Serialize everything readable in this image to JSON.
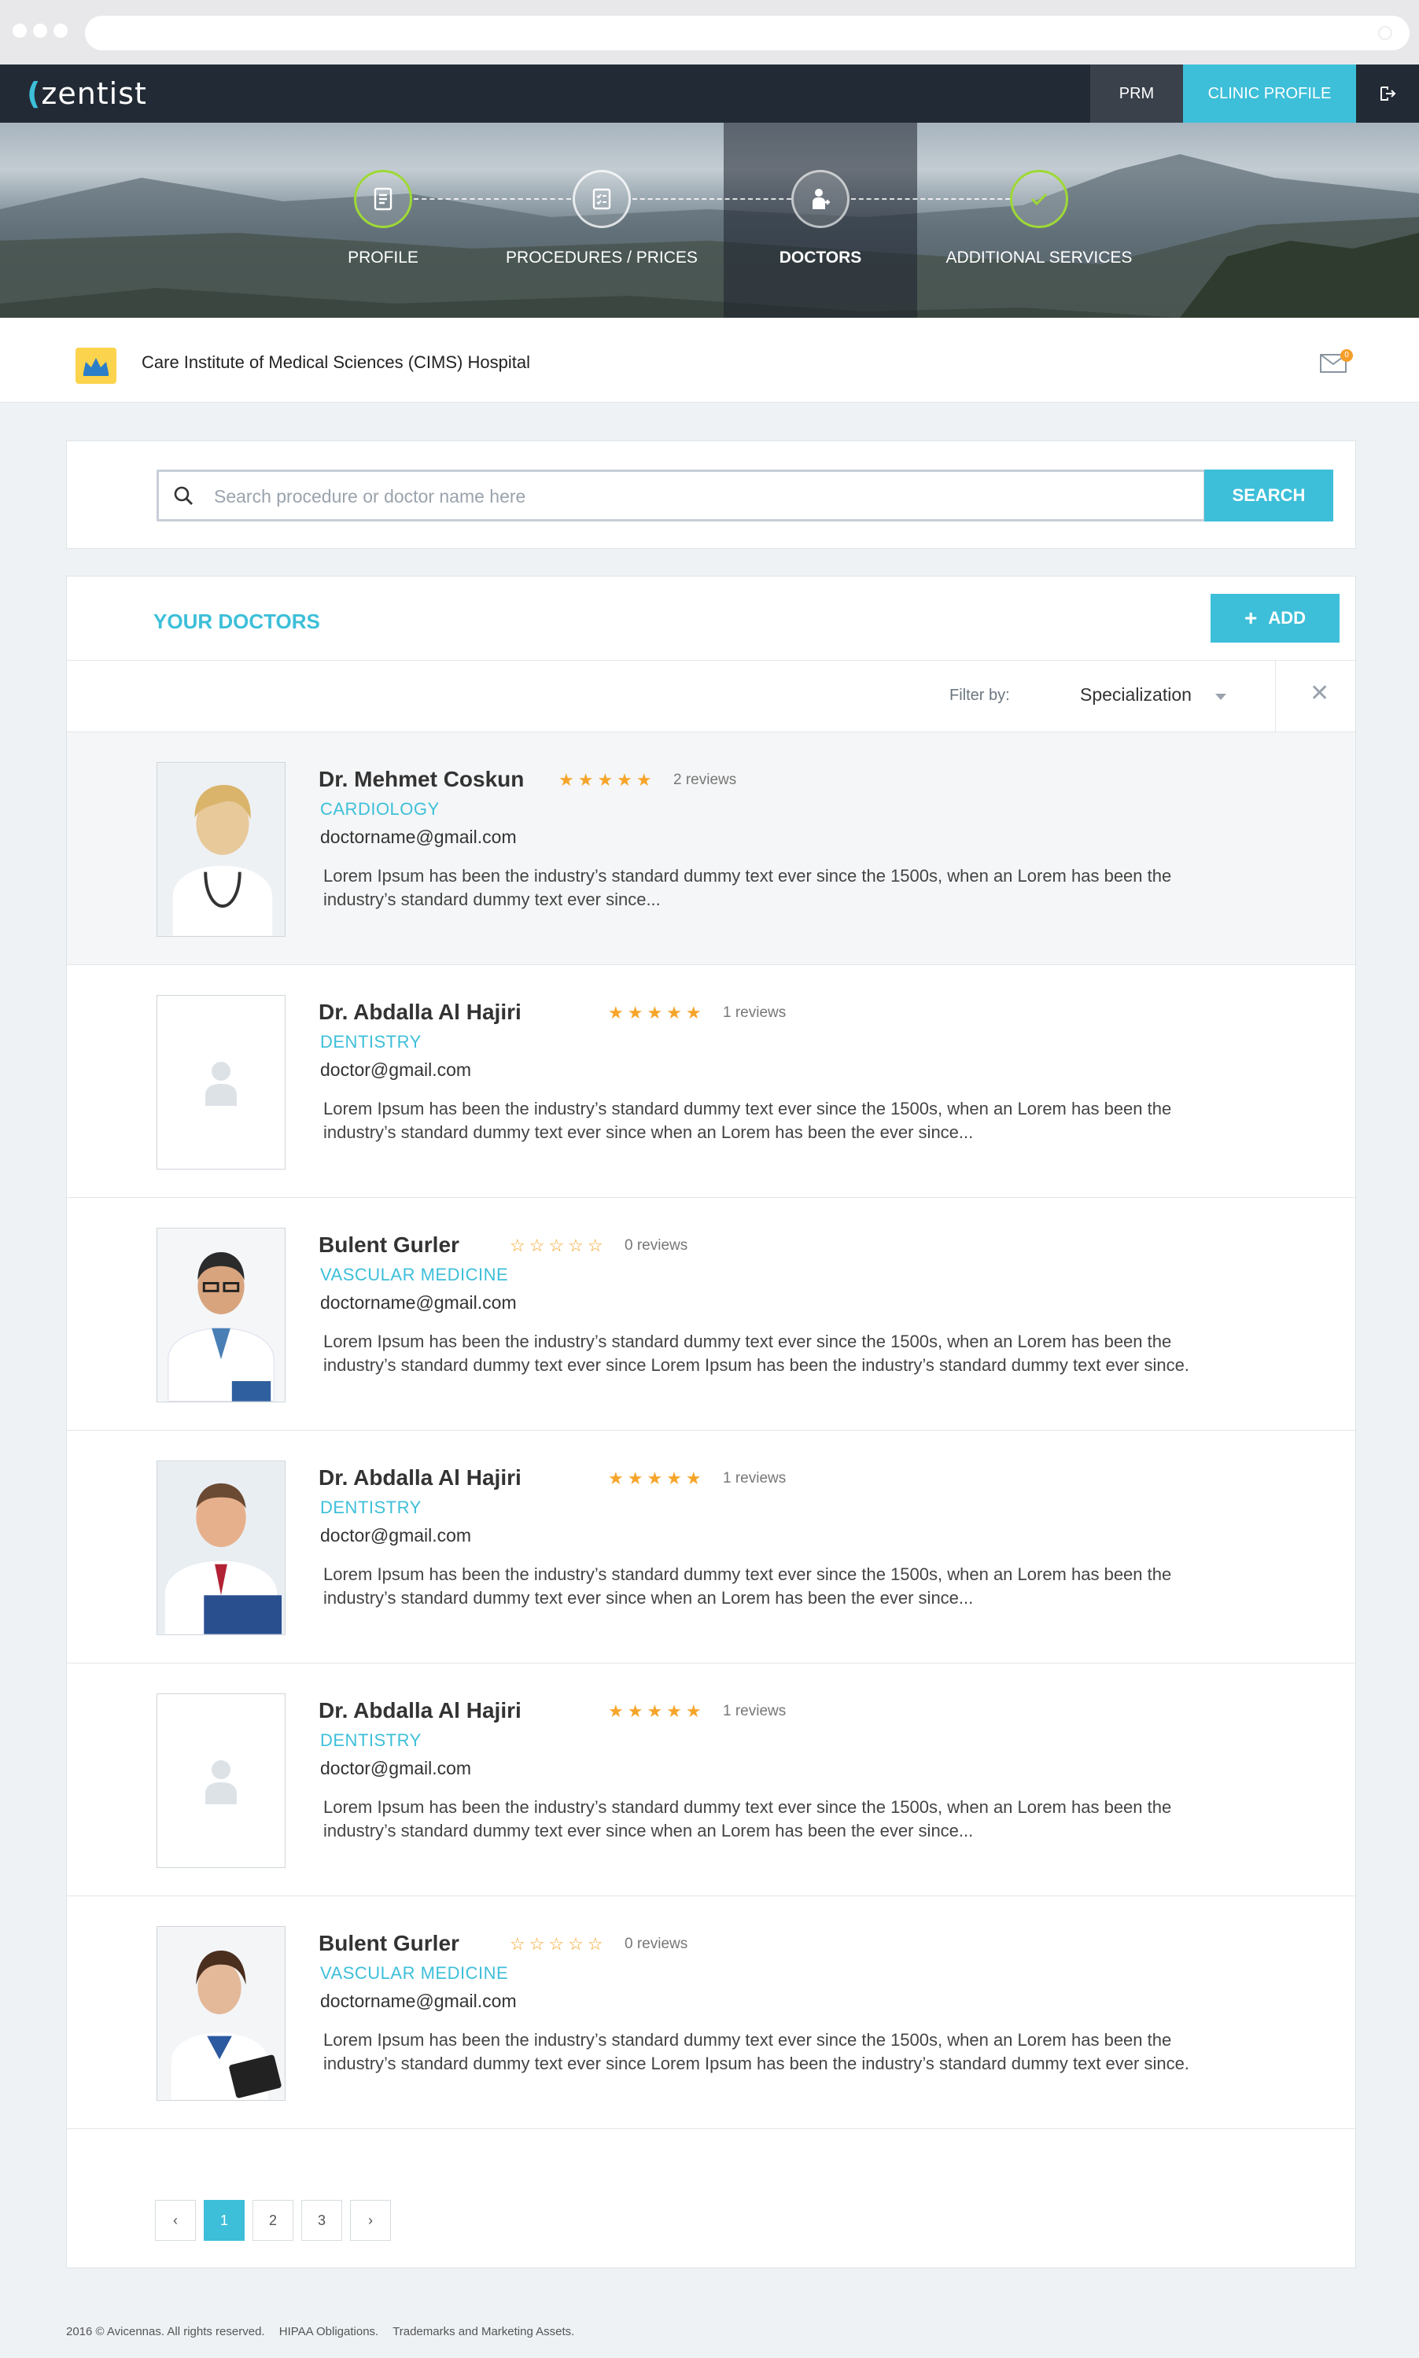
{
  "nav": {
    "logo": "zentist",
    "prm": "PRM",
    "clinic_profile": "CLINIC PROFILE"
  },
  "steps": [
    {
      "label": "PROFILE",
      "done": true
    },
    {
      "label": "PROCEDURES / PRICES",
      "done": false
    },
    {
      "label": "DOCTORS",
      "active": true
    },
    {
      "label": "ADDITIONAL SERVICES",
      "done": true
    }
  ],
  "clinic": {
    "name": "Care Institute of Medical Sciences (CIMS) Hospital",
    "notification_count": "0"
  },
  "search": {
    "placeholder": "Search procedure or doctor name here",
    "button": "SEARCH"
  },
  "doctors_panel": {
    "title": "YOUR DOCTORS",
    "add_label": "ADD",
    "filter_label": "Filter by:",
    "filter_value": "Specialization"
  },
  "doctors": [
    {
      "name": "Dr. Mehmet Coskun",
      "reviews": "2 reviews",
      "rating": 5,
      "specialty": "CARDIOLOGY",
      "email": "doctorname@gmail.com",
      "photo": "female-doctor",
      "line1": "Lorem Ipsum has been the industry’s standard dummy text ever since the 1500s, when an Lorem has been the",
      "line2": "industry’s standard dummy text ever since..."
    },
    {
      "name": "Dr. Abdalla Al Hajiri",
      "reviews": "1 reviews",
      "rating": 5,
      "specialty": "DENTISTRY",
      "email": "doctor@gmail.com",
      "photo": "placeholder",
      "line1": "Lorem Ipsum has been the industry’s standard dummy text ever since the 1500s, when an Lorem has been the",
      "line2": "industry’s standard dummy text ever since when an Lorem has been the ever since..."
    },
    {
      "name": "Bulent Gurler",
      "reviews": "0 reviews",
      "rating": 0,
      "specialty": "VASCULAR MEDICINE",
      "email": "doctorname@gmail.com",
      "photo": "male-doctor-glasses",
      "line1": "Lorem Ipsum has been the industry’s standard dummy text ever since the 1500s, when an Lorem has been the",
      "line2": "industry’s standard dummy text ever since Lorem Ipsum has been the industry’s standard dummy text ever since."
    },
    {
      "name": "Dr. Abdalla Al Hajiri",
      "reviews": "1 reviews",
      "rating": 5,
      "specialty": "DENTISTRY",
      "email": "doctor@gmail.com",
      "photo": "male-doctor-smiling",
      "line1": "Lorem Ipsum has been the industry’s standard dummy text ever since the 1500s, when an Lorem has been the",
      "line2": "industry’s standard dummy text ever since when an Lorem has been the ever since..."
    },
    {
      "name": "Dr. Abdalla Al Hajiri",
      "reviews": "1 reviews",
      "rating": 5,
      "specialty": "DENTISTRY",
      "email": "doctor@gmail.com",
      "photo": "placeholder",
      "line1": "Lorem Ipsum has been the industry’s standard dummy text ever since the 1500s, when an Lorem has been the",
      "line2": "industry’s standard dummy text ever since when an Lorem has been the ever since..."
    },
    {
      "name": "Bulent Gurler",
      "reviews": "0 reviews",
      "rating": 0,
      "specialty": "VASCULAR MEDICINE",
      "email": "doctorname@gmail.com",
      "photo": "female-doctor-tablet",
      "line1": "Lorem Ipsum has been the industry’s standard dummy text ever since the 1500s, when an Lorem has been the",
      "line2": "industry’s standard dummy text ever since Lorem Ipsum has been the industry’s standard dummy text ever since."
    }
  ],
  "pagination": {
    "prev": "‹",
    "pages": [
      "1",
      "2",
      "3"
    ],
    "current": "1",
    "next": "›"
  },
  "footer": [
    "2016 © Avicennas. All rights reserved.",
    "HIPAA Obligations.",
    "Trademarks and Marketing Assets."
  ],
  "colors": {
    "accent": "#3dbfd9",
    "nav": "#222a35",
    "star": "#f6a52a",
    "done": "#9ed936"
  }
}
